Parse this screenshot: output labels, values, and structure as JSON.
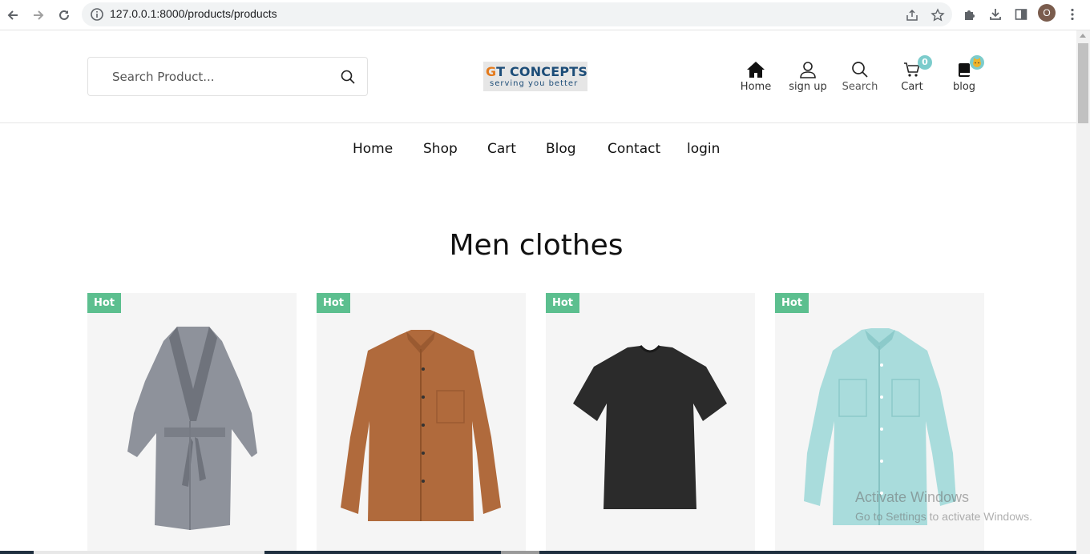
{
  "browser": {
    "url": "127.0.0.1:8000/products/products",
    "profile_initial": "O"
  },
  "header": {
    "search_placeholder": "Search Product...",
    "logo": {
      "brand_g": "G",
      "brand_rest": "T CONCEPTS",
      "tagline": "serving you better"
    },
    "icons": [
      {
        "label": "Home",
        "icon": "home-icon"
      },
      {
        "label": "sign up",
        "icon": "user-icon"
      },
      {
        "label": "Search",
        "icon": "search-icon"
      },
      {
        "label": "Cart",
        "icon": "cart-icon",
        "badge": "0"
      },
      {
        "label": "blog",
        "icon": "book-icon"
      }
    ]
  },
  "nav": {
    "items": [
      "Home",
      "Shop",
      "Cart",
      "Blog",
      "Contact",
      "login"
    ]
  },
  "section": {
    "title": "Men clothes"
  },
  "products": [
    {
      "badge": "Hot",
      "image": "bathrobe-image"
    },
    {
      "badge": "Hot",
      "image": "brown-shirt-image"
    },
    {
      "badge": "Hot",
      "image": "black-tshirt-image"
    },
    {
      "badge": "Hot",
      "image": "light-blue-shirt-image"
    }
  ],
  "watermark": {
    "line1": "Activate Windows",
    "line2": "Go to Settings to activate Windows."
  },
  "colors": {
    "accent_green": "#5cbf8f",
    "badge_teal": "#7ccccc",
    "logo_blue": "#1d4d78",
    "logo_orange": "#e47a1c"
  }
}
